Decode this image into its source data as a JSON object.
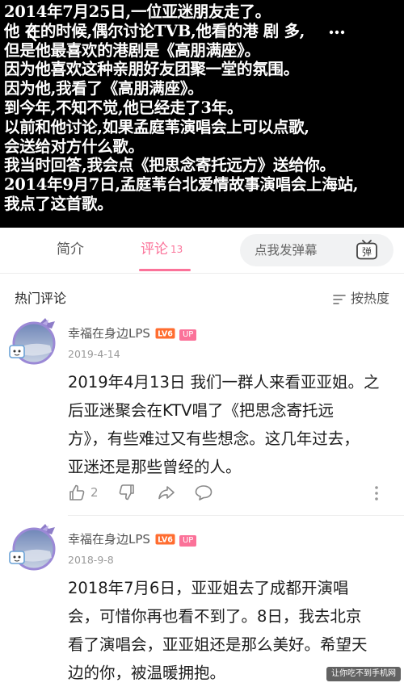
{
  "video": {
    "subtitle_lines": [
      "2014年7月25日,一位亚迷朋友走了。",
      "他 在的时候,偶尔讨论TVB,他看的港 剧 多,",
      "但是他最喜欢的港剧是《高朋满座》。",
      "因为他喜欢这种亲朋好友团聚一堂的氛围。",
      "因为他,我看了《高朋满座》。",
      "到今年,不知不觉,他已经走了3年。",
      "以前和他讨论,如果孟庭苇演唱会上可以点歌,",
      "会送给对方什么歌。",
      "我当时回答,我会点《把思念寄托远方》送给你。",
      "2014年9月7日,孟庭苇台北爱情故事演唱会上海站,",
      "我点了这首歌。"
    ]
  },
  "tabs": {
    "intro": "简介",
    "comments": "评论",
    "comments_count": "13",
    "danmaku_placeholder": "点我发弹幕",
    "danmaku_icon_label": "弹"
  },
  "hot": {
    "title": "热门评论",
    "sort_label": "按热度"
  },
  "comments": [
    {
      "username": "幸福在身边LPS",
      "level": "LV6",
      "badge": "UP",
      "date": "2019-4-14",
      "text_lines": [
        "2019年4月13日 我们一群人来看亚亚姐。之",
        "后亚迷聚会在KTV唱了《把思念寄托远",
        "方》，有些难过又有些想念。这几年过去，",
        "亚迷还是那些曾经的人。"
      ],
      "likes": "2"
    },
    {
      "username": "幸福在身边LPS",
      "level": "LV6",
      "badge": "UP",
      "date": "2018-9-8",
      "text_lines": [
        "2018年7月6日，亚亚姐去了成都开演唱",
        "会，可惜你再也看不到了。8日，我去北京",
        "看了演唱会，亚亚姐还是那么美好。希望天",
        "边的你，被温暖拥抱。"
      ]
    }
  ],
  "watermark": "让你吃不到手机网",
  "colors": {
    "accent": "#fb7299",
    "video_bg": "#000000"
  }
}
